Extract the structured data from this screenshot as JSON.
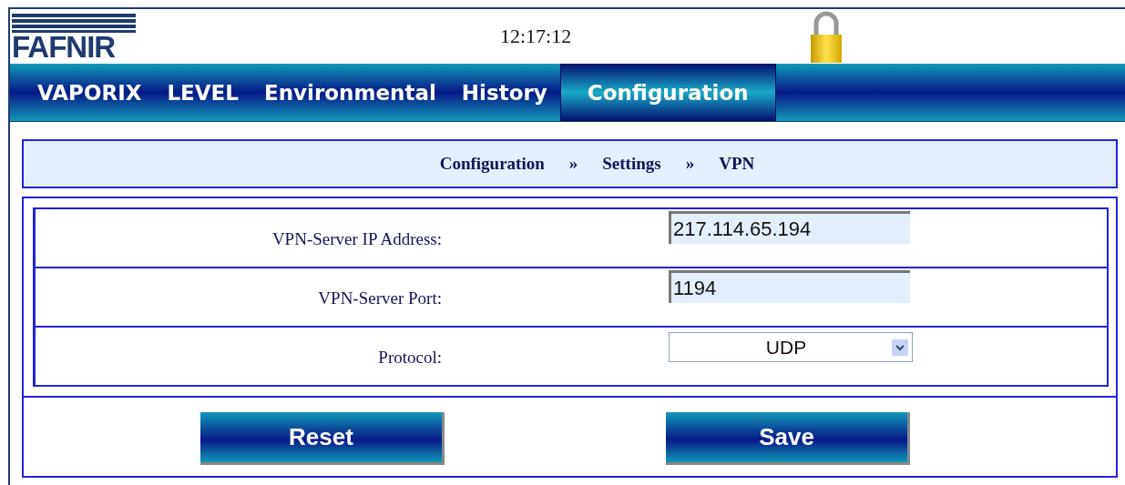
{
  "header": {
    "logo": "FAFNIR",
    "time": "12:17:12"
  },
  "tabs": [
    {
      "label": "VAPORIX",
      "selected": false
    },
    {
      "label": "LEVEL",
      "selected": false
    },
    {
      "label": "Environmental",
      "selected": false
    },
    {
      "label": "History",
      "selected": false
    },
    {
      "label": "Configuration",
      "selected": true
    }
  ],
  "breadcrumb": [
    {
      "label": "Configuration"
    },
    {
      "label": "»"
    },
    {
      "label": "Settings"
    },
    {
      "label": "»"
    },
    {
      "label": "VPN"
    }
  ],
  "form": {
    "rows": [
      {
        "kind": "input",
        "label": "VPN-Server IP Address:",
        "value": "217.114.65.194"
      },
      {
        "kind": "input",
        "label": "VPN-Server Port:",
        "value": "1194"
      },
      {
        "kind": "select",
        "label": "Protocol:",
        "value": "UDP"
      }
    ]
  },
  "buttons": [
    "Reset",
    "Save"
  ]
}
